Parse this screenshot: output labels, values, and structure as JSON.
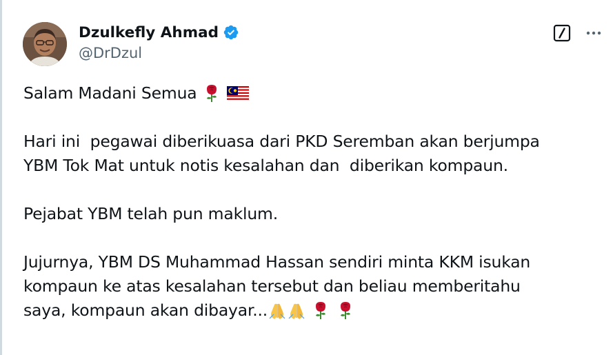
{
  "author": {
    "display_name": "Dzulkefly Ahmad",
    "handle": "@DrDzul",
    "verified": true,
    "avatar_icon": "profile-photo"
  },
  "actions": {
    "grok_icon": "grok-icon",
    "more_icon": "more-options-icon"
  },
  "colors": {
    "text": "#0f1419",
    "secondary_text": "#536471",
    "verified_blue": "#1d9bf0",
    "divider": "#cfd9de"
  },
  "tweet": {
    "line1": "Salam Madani Semua",
    "line2": "Hari ini  pegawai diberikuasa dari PKD Seremban akan berjumpa",
    "line3": "YBM Tok Mat untuk notis kesalahan dan  diberikan kompaun.",
    "line4": "Pejabat YBM telah pun maklum.",
    "line5": "Jujurnya, YBM DS Muhammad Hassan sendiri minta KKM isukan",
    "line6": "kompaun ke atas kesalahan tersebut dan beliau memberitahu",
    "line7": "saya, kompaun akan dibayar...",
    "emoji_line1": [
      "rose-emoji",
      "malaysia-flag-emoji"
    ],
    "emoji_line7": [
      "folded-hands-emoji",
      "folded-hands-emoji",
      "rose-emoji",
      "rose-emoji"
    ]
  }
}
